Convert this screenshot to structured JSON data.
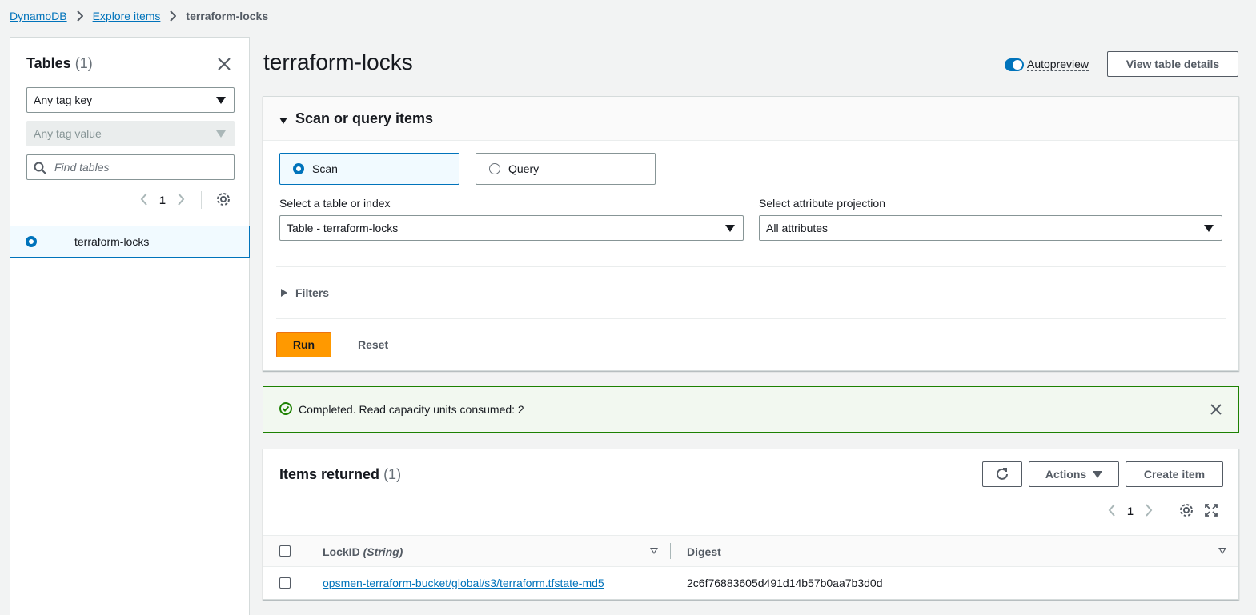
{
  "breadcrumb": {
    "item1": "DynamoDB",
    "item2": "Explore items",
    "current": "terraform-locks"
  },
  "sidebar": {
    "title": "Tables",
    "count": "(1)",
    "tag_key": "Any tag key",
    "tag_value": "Any tag value",
    "search_placeholder": "Find tables",
    "page": "1",
    "tables": [
      {
        "name": "terraform-locks",
        "selected": true
      }
    ]
  },
  "header": {
    "title": "terraform-locks",
    "autopreview_label": "Autopreview",
    "autopreview_on": true,
    "view_details_label": "View table details"
  },
  "scan_panel": {
    "title": "Scan or query items",
    "mode_scan": "Scan",
    "mode_query": "Query",
    "selected_mode": "Scan",
    "table_label": "Select a table or index",
    "table_value": "Table - terraform-locks",
    "projection_label": "Select attribute projection",
    "projection_value": "All attributes",
    "filters_label": "Filters",
    "run_label": "Run",
    "reset_label": "Reset"
  },
  "alert": {
    "message": "Completed. Read capacity units consumed: 2",
    "status_color": "#1d8102"
  },
  "items": {
    "title": "Items returned",
    "count": "(1)",
    "actions_label": "Actions",
    "create_label": "Create item",
    "page": "1",
    "columns": {
      "lockid": "LockID",
      "lockid_type": "(String)",
      "digest": "Digest"
    },
    "rows": [
      {
        "lockid": "opsmen-terraform-bucket/global/s3/terraform.tfstate-md5",
        "digest": "2c6f76883605d491d14b57b0aa7b3d0d"
      }
    ]
  },
  "colors": {
    "accent": "#0073bb",
    "primary_button": "#ff9900",
    "background": "#f2f3f3"
  }
}
